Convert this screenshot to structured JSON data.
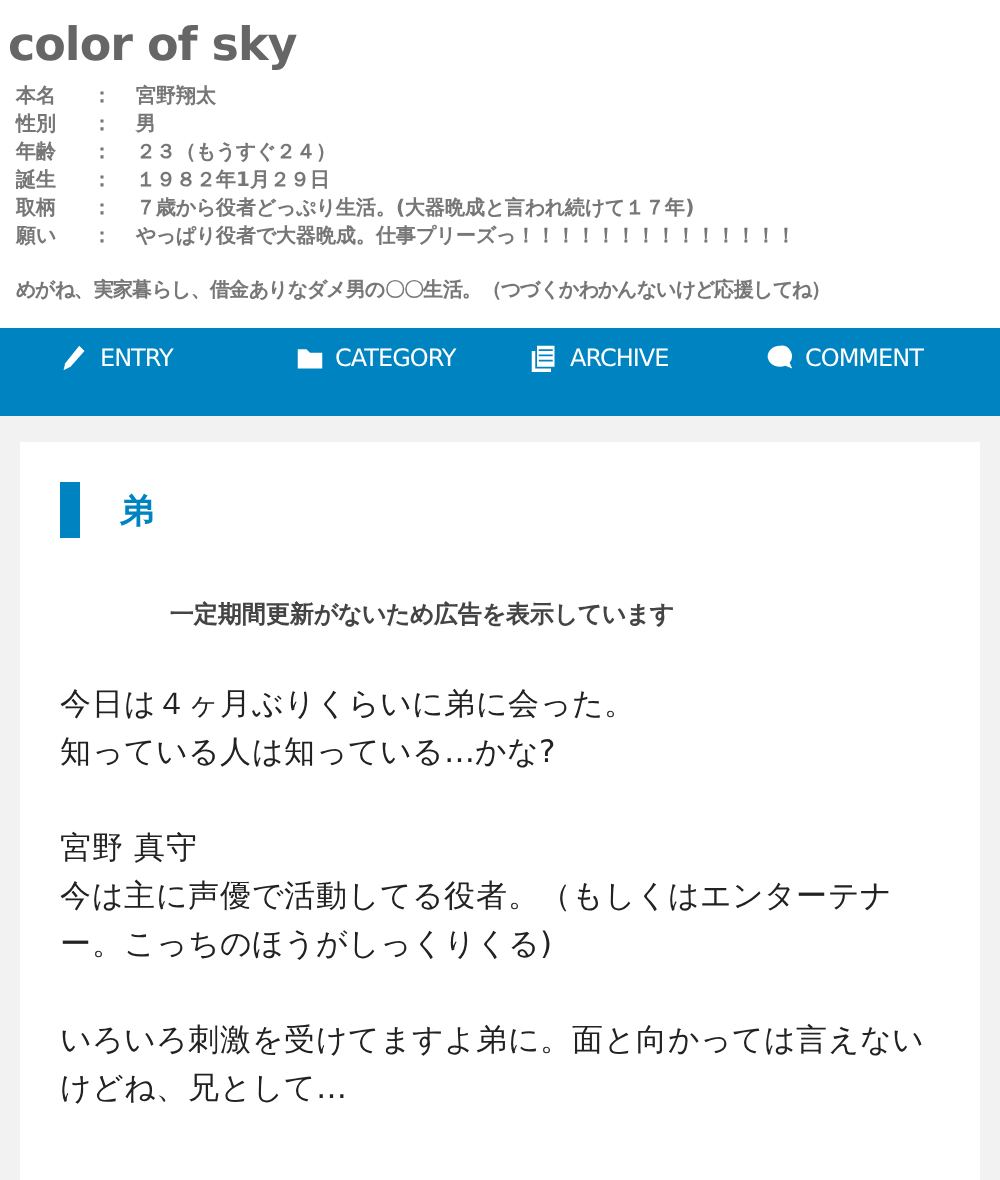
{
  "site": {
    "title": "color of sky",
    "profile": [
      {
        "label": "本名",
        "separator": "：",
        "value": "宮野翔太"
      },
      {
        "label": "性別",
        "separator": "：",
        "value": "男"
      },
      {
        "label": "年齢",
        "separator": "：",
        "value": "２３（もうすぐ２４）"
      },
      {
        "label": "誕生",
        "separator": "：",
        "value": "１９８２年1月２９日"
      },
      {
        "label": "取柄",
        "separator": "：",
        "value": "７歳から役者どっぷり生活。(大器晩成と言われ続けて１７年)"
      },
      {
        "label": "願い",
        "separator": "：",
        "value": "やっぱり役者で大器晩成。仕事プリーズっ！！！！！！！！！！！！！！"
      }
    ],
    "tagline": "めがね、実家暮らし、借金ありなダメ男の〇〇生活。（つづくかわかんないけど応援してね）"
  },
  "nav": [
    {
      "kind": "entry",
      "label": "ENTRY"
    },
    {
      "kind": "category",
      "label": "CATEGORY"
    },
    {
      "kind": "archive",
      "label": "ARCHIVE"
    },
    {
      "kind": "comment",
      "label": "COMMENT"
    }
  ],
  "post": {
    "title": "弟",
    "notice": "一定期間更新がないため広告を表示しています",
    "paragraphs": [
      [
        "今日は４ヶ月ぶりくらいに弟に会った。",
        "知っている人は知っている…かな?"
      ],
      [
        "宮野 真守",
        "今は主に声優で活動してる役者。（もしくはエンターテナー。こっちのほうがしっくりくる)"
      ],
      [
        "いろいろ刺激を受けてますよ弟に。面と向かっては言えないけどね、兄として…"
      ]
    ]
  }
}
